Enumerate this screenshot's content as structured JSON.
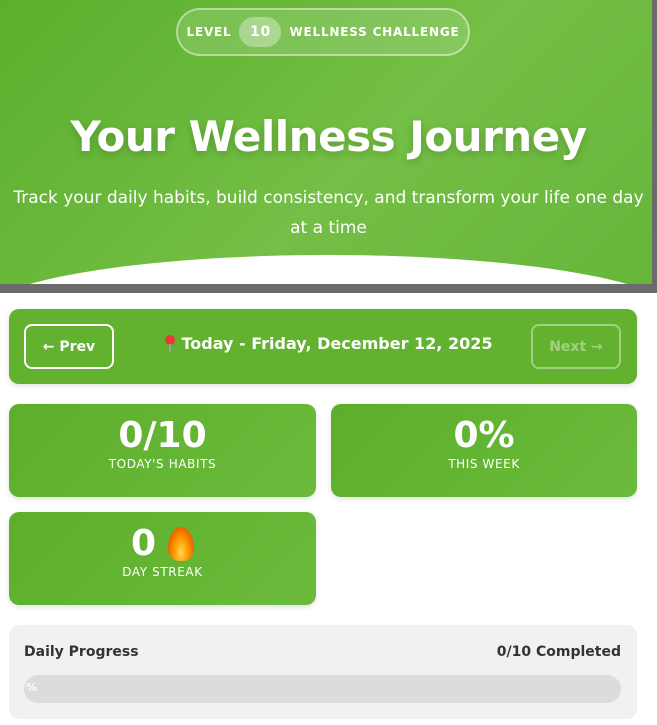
{
  "hero": {
    "badge_left": "LEVEL",
    "badge_level": "10",
    "badge_right": "WELLNESS CHALLENGE",
    "title": "Your Wellness Journey",
    "subtitle": "Track your daily habits, build consistency, and transform your life one day at a time"
  },
  "nav": {
    "prev_label": "← Prev",
    "date_label": "Today - Friday, December 12, 2025",
    "next_label": "Next →",
    "pin_icon": "pin-icon"
  },
  "stats": {
    "habits_value": "0/10",
    "habits_label": "TODAY'S HABITS",
    "week_value": "0%",
    "week_label": "THIS WEEK",
    "streak_value": "0",
    "streak_label": "DAY STREAK",
    "streak_icon": "fire-icon"
  },
  "progress": {
    "title": "Daily Progress",
    "count": "0/10 Completed",
    "percent_text": "%",
    "fraction": 0
  },
  "colors": {
    "brand_green": "#62b12f",
    "track_gray": "#dcdcdc"
  }
}
